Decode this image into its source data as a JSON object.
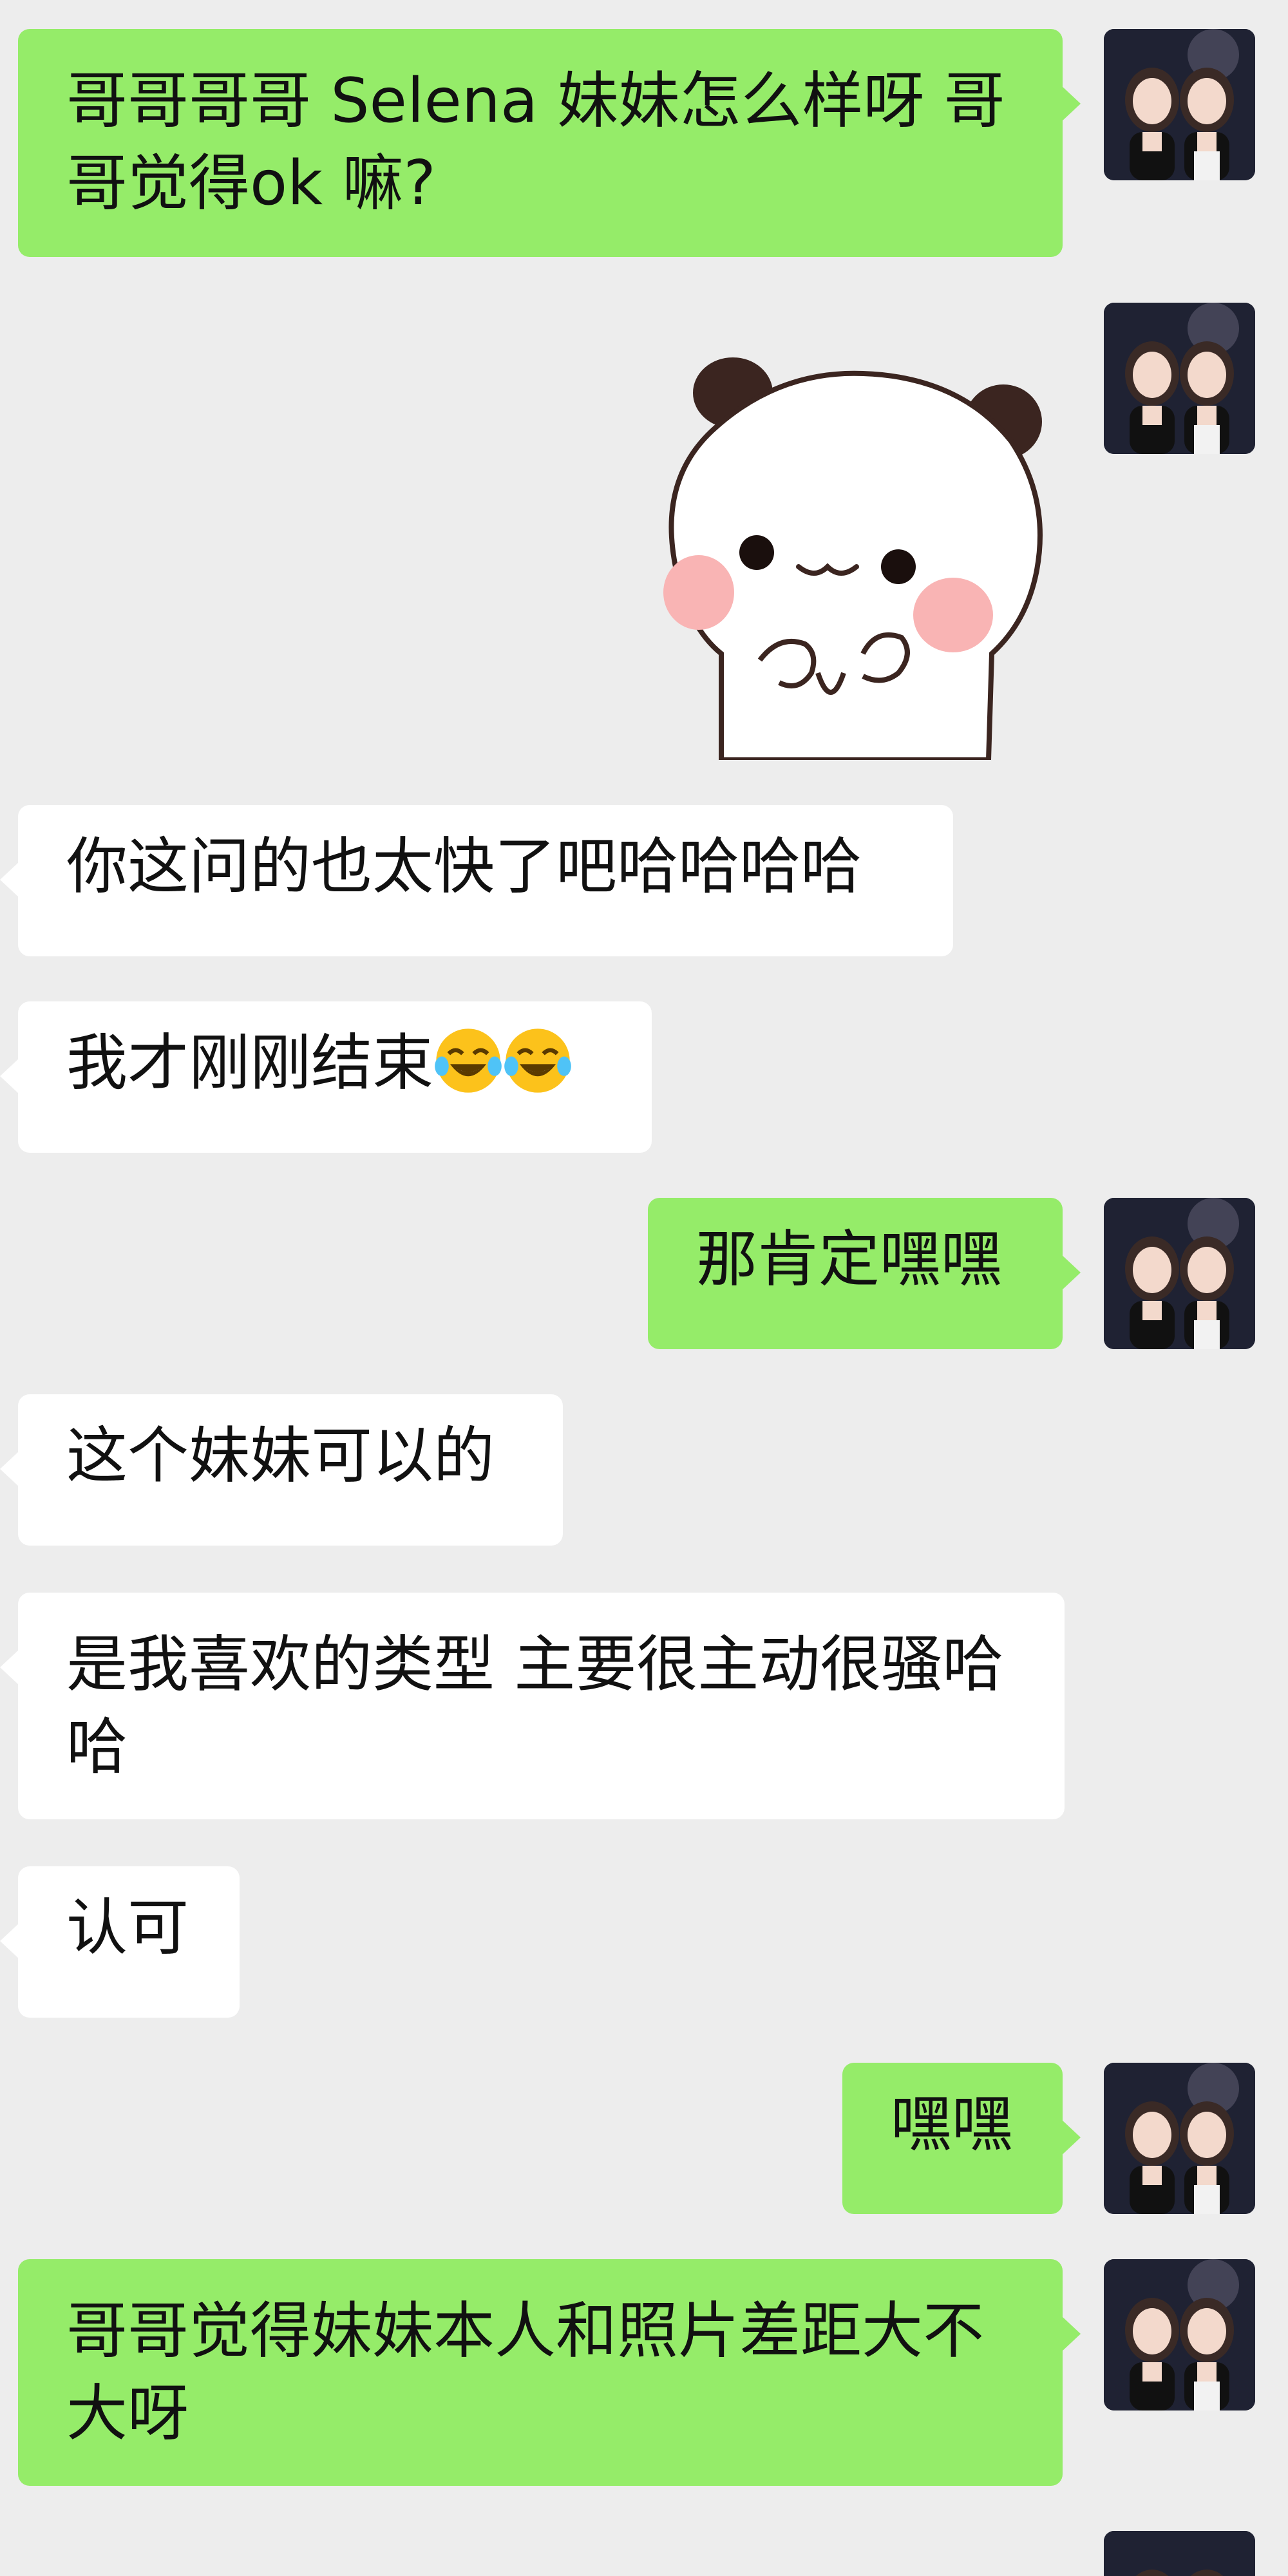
{
  "chat": {
    "messages": [
      {
        "side": "right",
        "type": "text",
        "text": "哥哥哥哥 Selena 妹妹怎么样呀 哥哥觉得ok 嘛?"
      },
      {
        "side": "right",
        "type": "sticker",
        "sticker": "panda-bear-sticker"
      },
      {
        "side": "left",
        "type": "text",
        "text": "你这问的也太快了吧哈哈哈哈"
      },
      {
        "side": "left",
        "type": "text",
        "text": "我才刚刚结束",
        "emoji": [
          "tears-of-joy-emoji",
          "tears-of-joy-emoji"
        ]
      },
      {
        "side": "right",
        "type": "text",
        "text": "那肯定嘿嘿"
      },
      {
        "side": "left",
        "type": "text",
        "text": "这个妹妹可以的"
      },
      {
        "side": "left",
        "type": "text",
        "text": "是我喜欢的类型 主要很主动很骚哈哈"
      },
      {
        "side": "left",
        "type": "text",
        "text": "认可"
      },
      {
        "side": "right",
        "type": "text",
        "text": "嘿嘿"
      },
      {
        "side": "right",
        "type": "text",
        "text": "哥哥觉得妹妹本人和照片差距大不大呀"
      }
    ]
  },
  "colors": {
    "background": "#ededed",
    "sent_bubble": "#95ec69",
    "received_bubble": "#ffffff"
  }
}
